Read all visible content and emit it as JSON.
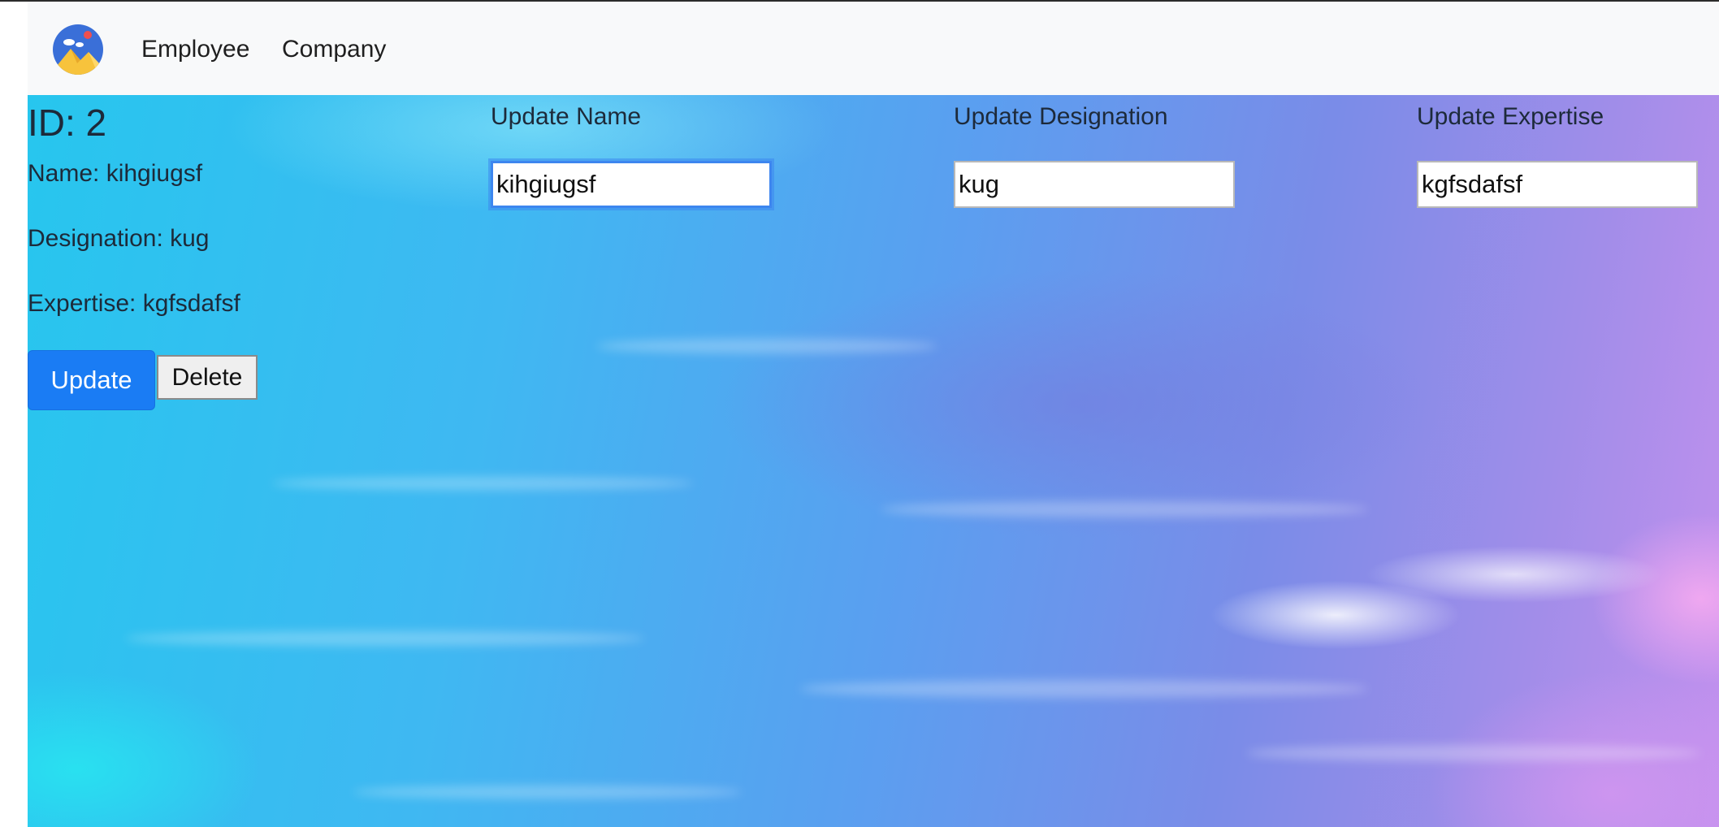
{
  "navbar": {
    "brand_icon": "mountain-sun-logo-icon",
    "links": [
      "Employee",
      "Company"
    ]
  },
  "employee": {
    "id_label": "ID: 2",
    "name_line": "Name: kihgiugsf",
    "designation_line": "Designation: kug",
    "expertise_line": "Expertise: kgfsdafsf"
  },
  "actions": {
    "update_label": "Update",
    "delete_label": "Delete"
  },
  "form": {
    "name_label": "Update Name",
    "name_value": "kihgiugsf",
    "designation_label": "Update Designation",
    "designation_value": "kug",
    "expertise_label": "Update Expertise",
    "expertise_value": "kgfsdafsf"
  },
  "colors": {
    "primary_button": "#1a7cf4",
    "navbar_bg": "#f8f9fa",
    "focus_ring": "#3d86ef"
  }
}
